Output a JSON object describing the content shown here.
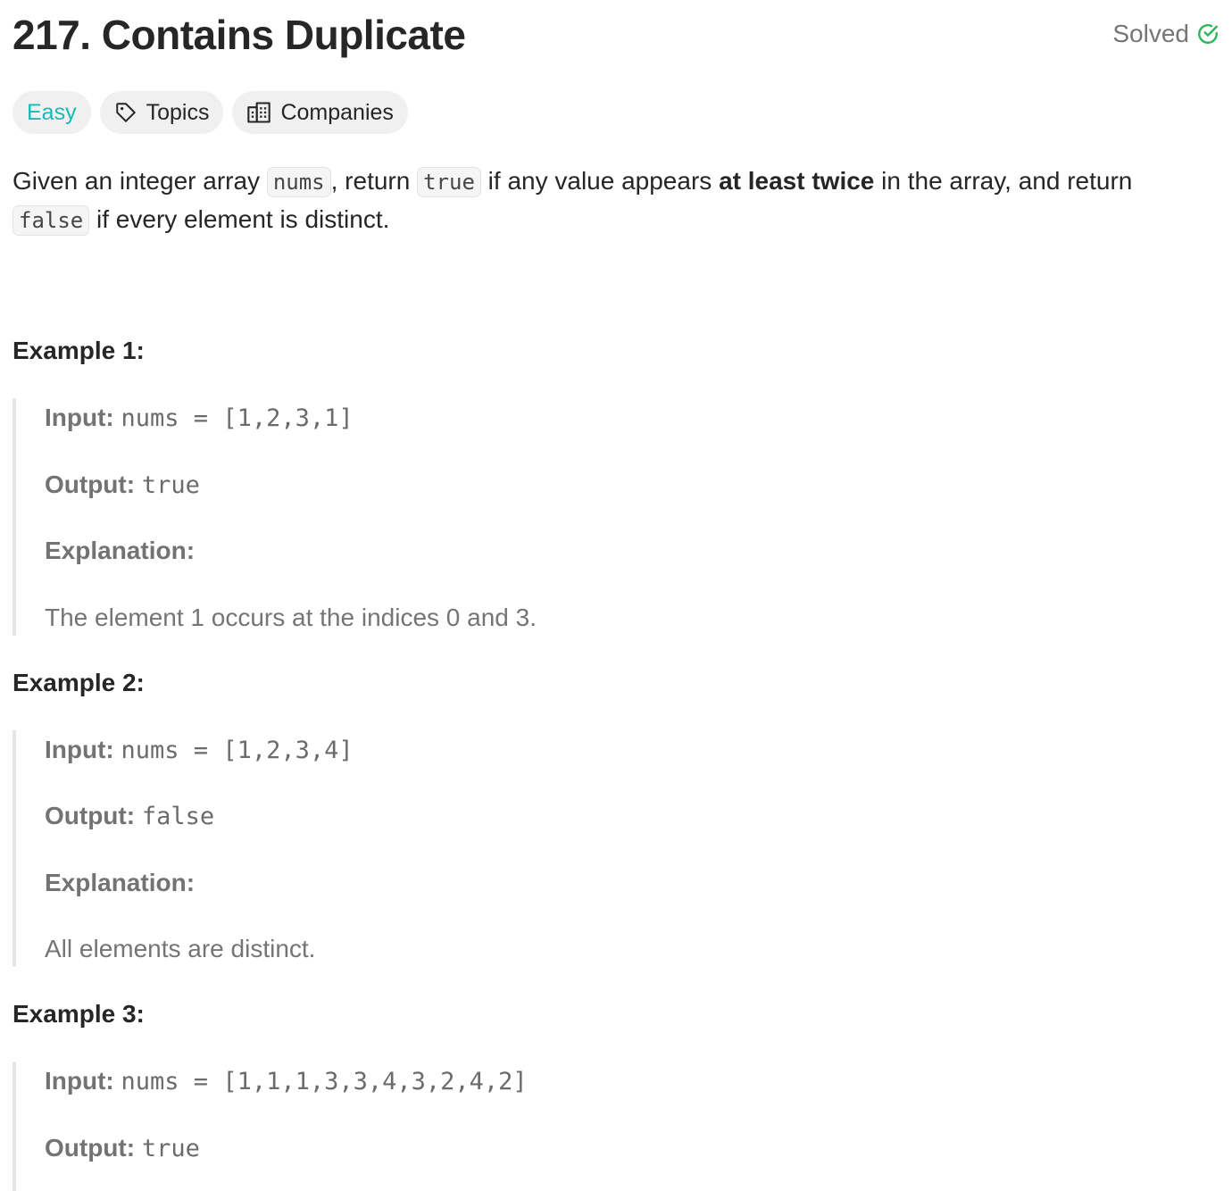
{
  "problem": {
    "number_title": "217. Contains Duplicate",
    "status": "Solved",
    "status_color": "#2db55d"
  },
  "tags": {
    "difficulty": "Easy",
    "topics": "Topics",
    "companies": "Companies"
  },
  "description": {
    "part1": "Given an integer array ",
    "code_nums": "nums",
    "part2": ", return ",
    "code_true": "true",
    "part3": " if any value appears ",
    "bold": "at least twice",
    "part4": " in the array, and return",
    "code_false": "false",
    "part5": " if every element is distinct."
  },
  "labels": {
    "input": "Input:",
    "output": "Output:",
    "explanation": "Explanation:"
  },
  "examples": [
    {
      "title": "Example 1:",
      "input": "nums = [1,2,3,1]",
      "output": "true",
      "explanation_text": "The element 1 occurs at the indices 0 and 3."
    },
    {
      "title": "Example 2:",
      "input": "nums = [1,2,3,4]",
      "output": "false",
      "explanation_text": "All elements are distinct."
    },
    {
      "title": "Example 3:",
      "input": "nums = [1,1,1,3,3,4,3,2,4,2]",
      "output": "true"
    }
  ]
}
